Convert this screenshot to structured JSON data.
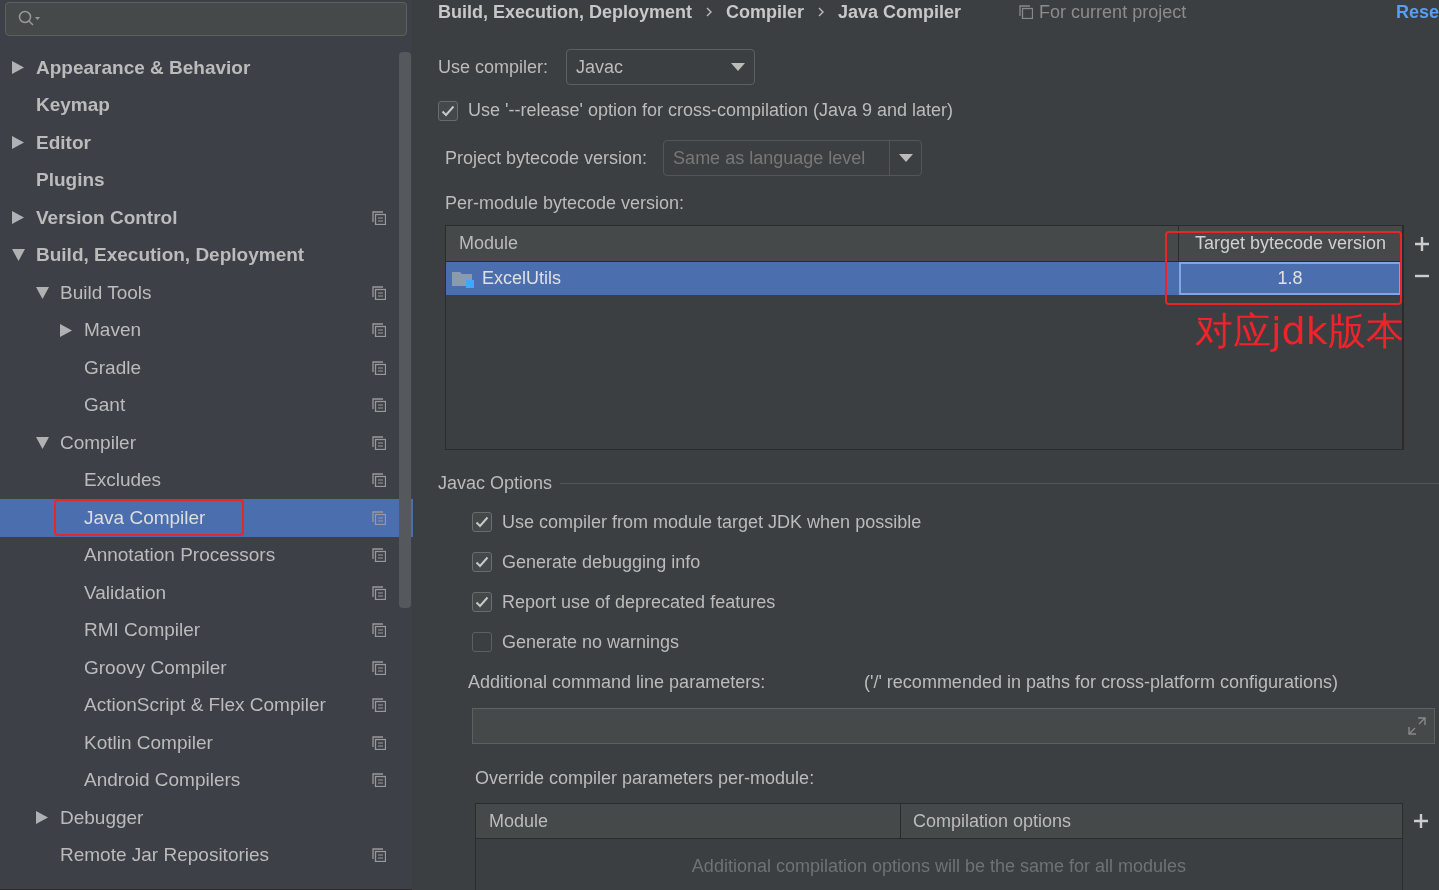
{
  "sidebar": {
    "tree": [
      {
        "label": "Appearance & Behavior",
        "expanded": false,
        "project_scope": false,
        "selected": false
      },
      {
        "label": "Keymap",
        "project_scope": false,
        "selected": false
      },
      {
        "label": "Editor",
        "expanded": false,
        "project_scope": false,
        "selected": false
      },
      {
        "label": "Plugins",
        "project_scope": false,
        "selected": false
      },
      {
        "label": "Version Control",
        "expanded": false,
        "project_scope": true,
        "selected": false
      },
      {
        "label": "Build, Execution, Deployment",
        "expanded": true,
        "project_scope": false,
        "selected": false,
        "children": [
          {
            "label": "Build Tools",
            "expanded": true,
            "project_scope": true,
            "selected": false,
            "children": [
              {
                "label": "Maven",
                "expanded": false,
                "project_scope": true,
                "selected": false
              },
              {
                "label": "Gradle",
                "project_scope": true,
                "selected": false
              },
              {
                "label": "Gant",
                "project_scope": true,
                "selected": false
              }
            ]
          },
          {
            "label": "Compiler",
            "expanded": true,
            "project_scope": true,
            "selected": false,
            "children": [
              {
                "label": "Excludes",
                "project_scope": true,
                "selected": false
              },
              {
                "label": "Java Compiler",
                "project_scope": true,
                "selected": true,
                "outlined": true
              },
              {
                "label": "Annotation Processors",
                "project_scope": true,
                "selected": false
              },
              {
                "label": "Validation",
                "project_scope": true,
                "selected": false
              },
              {
                "label": "RMI Compiler",
                "project_scope": true,
                "selected": false
              },
              {
                "label": "Groovy Compiler",
                "project_scope": true,
                "selected": false
              },
              {
                "label": "ActionScript & Flex Compiler",
                "project_scope": true,
                "selected": false
              },
              {
                "label": "Kotlin Compiler",
                "project_scope": true,
                "selected": false
              },
              {
                "label": "Android Compilers",
                "project_scope": true,
                "selected": false
              }
            ]
          },
          {
            "label": "Debugger",
            "expanded": false,
            "project_scope": false,
            "selected": false
          },
          {
            "label": "Remote Jar Repositories",
            "project_scope": true,
            "selected": false
          }
        ]
      }
    ]
  },
  "breadcrumb": [
    "Build, Execution, Deployment",
    "Compiler",
    "Java Compiler"
  ],
  "scope_note": "For current project",
  "reset_link": "Rese",
  "use_compiler": {
    "label": "Use compiler:",
    "value": "Javac"
  },
  "release_option": {
    "label": "Use '--release' option for cross-compilation (Java 9 and later)",
    "checked": true
  },
  "project_bytecode": {
    "label": "Project bytecode version:",
    "placeholder": "Same as language level"
  },
  "per_module": {
    "label": "Per-module bytecode version:",
    "columns": [
      "Module",
      "Target bytecode version"
    ],
    "rows": [
      {
        "module": "ExcelUtils",
        "target": "1.8",
        "selected": true
      }
    ],
    "target_column_outlined": true,
    "annotation": "对应jdk版本"
  },
  "javac_options": {
    "title": "Javac Options",
    "checkboxes": [
      {
        "label": "Use compiler from module target JDK when possible",
        "checked": true
      },
      {
        "label": "Generate debugging info",
        "checked": true
      },
      {
        "label": "Report use of deprecated features",
        "checked": true
      },
      {
        "label": "Generate no warnings",
        "checked": false
      }
    ],
    "params_label": "Additional command line parameters:",
    "params_hint": "('/' recommended in paths for cross-platform configurations)",
    "override_label": "Override compiler parameters per-module:",
    "override_columns": [
      "Module",
      "Compilation options"
    ],
    "override_empty": "Additional compilation options will be the same for all modules"
  }
}
